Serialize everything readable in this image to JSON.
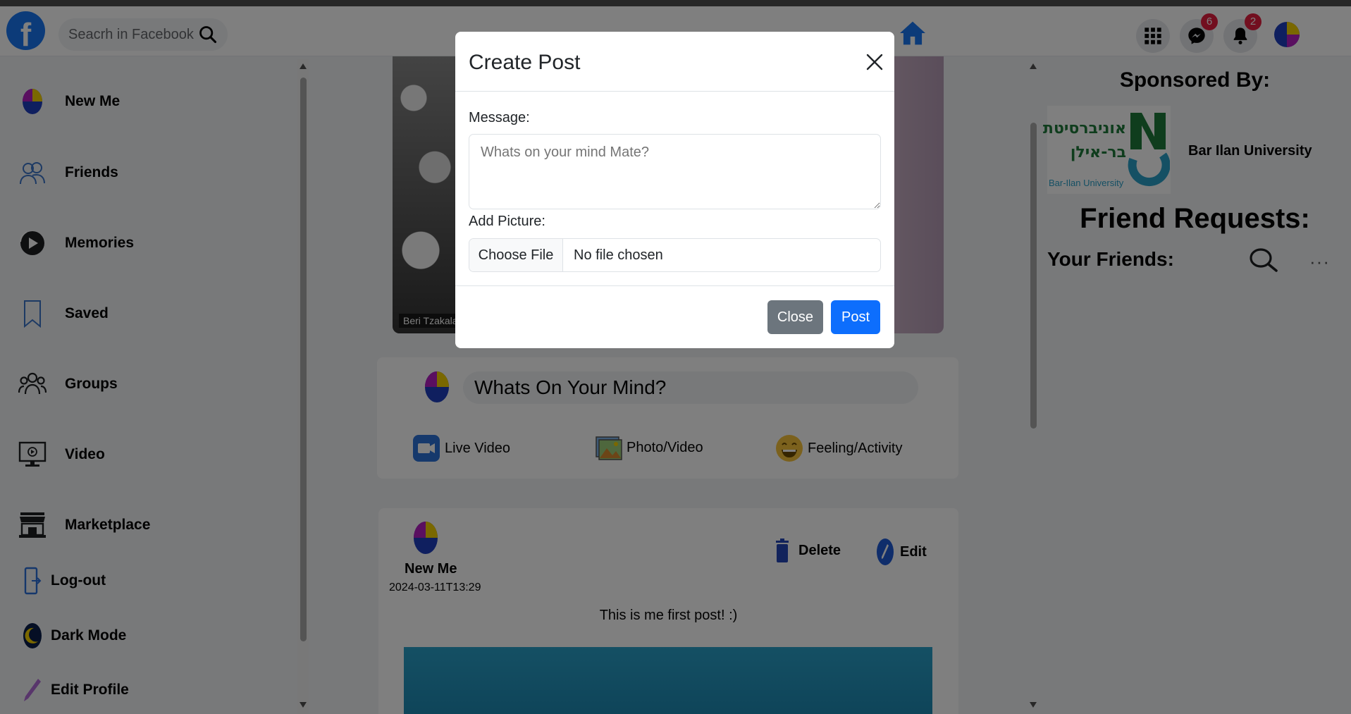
{
  "header": {
    "logo": "f",
    "search_placeholder": "Seacrh in Facebook",
    "messenger_badge": "6",
    "notifications_badge": "2"
  },
  "sidebar": {
    "items": [
      {
        "label": "New Me"
      },
      {
        "label": "Friends"
      },
      {
        "label": "Memories"
      },
      {
        "label": "Saved"
      },
      {
        "label": "Groups"
      },
      {
        "label": "Video"
      },
      {
        "label": "Marketplace"
      },
      {
        "label": "Log-out"
      },
      {
        "label": "Dark Mode"
      },
      {
        "label": "Edit Profile"
      }
    ]
  },
  "story": {
    "credit": "Beri Tzakala"
  },
  "composer": {
    "prompt": "Whats On Your Mind?",
    "actions": [
      {
        "label": "Live Video"
      },
      {
        "label": "Photo/Video"
      },
      {
        "label": "Feeling/Activity"
      }
    ]
  },
  "post": {
    "author": "New Me",
    "date": "2024-03-11T13:29",
    "delete_label": "Delete",
    "edit_label": "Edit",
    "text": "This is me first post! :)"
  },
  "right": {
    "sponsored_title": "Sponsored By:",
    "sponsor_name": "Bar Ilan University",
    "sponsor_logo_hebrew_line1": "אוניברסיטת",
    "sponsor_logo_hebrew_line2": "בר-אילן",
    "sponsor_logo_english": "Bar-Ilan University",
    "friend_requests_title": "Friend Requests:",
    "your_friends_title": "Your Friends:",
    "more": "···"
  },
  "modal": {
    "title": "Create Post",
    "message_label": "Message:",
    "message_placeholder": "Whats on your mind Mate?",
    "picture_label": "Add Picture:",
    "file_button": "Choose File",
    "file_status": "No file chosen",
    "close_button": "Close",
    "post_button": "Post"
  },
  "colors": {
    "brand": "#1877f2",
    "primary_button": "#0d6efd",
    "secondary_button": "#6c757d",
    "badge": "#e41e3f"
  }
}
